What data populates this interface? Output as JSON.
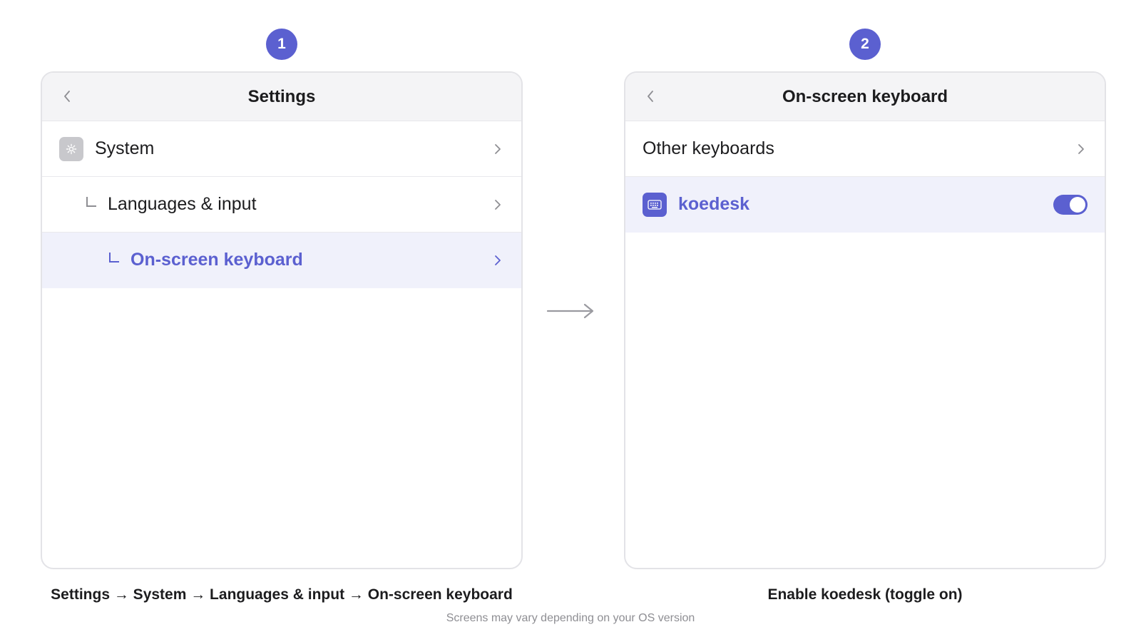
{
  "accent_color": "#5b60d0",
  "steps": [
    {
      "number": "1",
      "header": {
        "title": "Settings",
        "back_icon": "chevron-left-icon"
      },
      "rows": [
        {
          "label": "System",
          "icon": "gear-icon"
        },
        {
          "label": "Languages & input",
          "icon": "tree-branch-icon"
        },
        {
          "label": "On-screen keyboard",
          "icon": "tree-branch-icon",
          "selected": true
        }
      ],
      "caption": "Settings → System → Languages & input → On-screen keyboard"
    },
    {
      "number": "2",
      "header": {
        "title": "On-screen keyboard",
        "back_icon": "chevron-left-icon"
      },
      "rows": [
        {
          "label": "Other keyboards"
        },
        {
          "label": "koedesk",
          "icon": "keyboard-icon",
          "selected": true,
          "toggle": "on"
        }
      ],
      "caption": "Enable koedesk (toggle on)"
    }
  ],
  "between_icon": "arrow-right-icon",
  "footnote": "Screens may vary depending on your OS version"
}
